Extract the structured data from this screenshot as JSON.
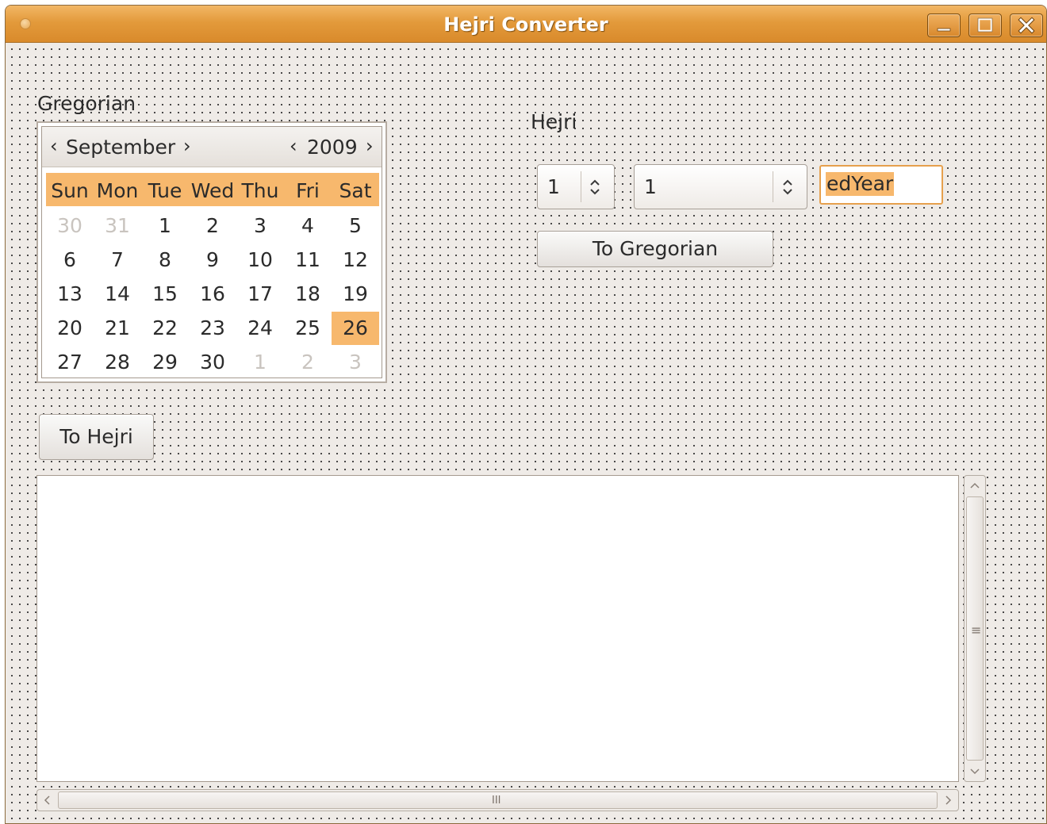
{
  "window": {
    "title": "Hejri Converter",
    "accent_color": "#e39a3b",
    "selection_color": "#f7b86d"
  },
  "gregorian": {
    "label": "Gregorian",
    "month": "September",
    "year": "2009",
    "prev_month_arrow": "‹",
    "next_month_arrow": "›",
    "prev_year_arrow": "‹",
    "next_year_arrow": "›",
    "day_names": [
      "Sun",
      "Mon",
      "Tue",
      "Wed",
      "Thu",
      "Fri",
      "Sat"
    ],
    "weeks": [
      [
        "30",
        "31",
        "1",
        "2",
        "3",
        "4",
        "5"
      ],
      [
        "6",
        "7",
        "8",
        "9",
        "10",
        "11",
        "12"
      ],
      [
        "13",
        "14",
        "15",
        "16",
        "17",
        "18",
        "19"
      ],
      [
        "20",
        "21",
        "22",
        "23",
        "24",
        "25",
        "26"
      ],
      [
        "27",
        "28",
        "29",
        "30",
        "1",
        "2",
        "3"
      ]
    ],
    "selected_day": "26",
    "convert_button": "To Hejri"
  },
  "hejri": {
    "label": "Hejri",
    "day_value": "1",
    "month_value": "1",
    "year_field": "edYear",
    "convert_button": "To Gregorian"
  },
  "memo": {
    "text": ""
  },
  "scrollbar": {
    "vertical_grip": "≡",
    "horizontal_grip": "III"
  }
}
